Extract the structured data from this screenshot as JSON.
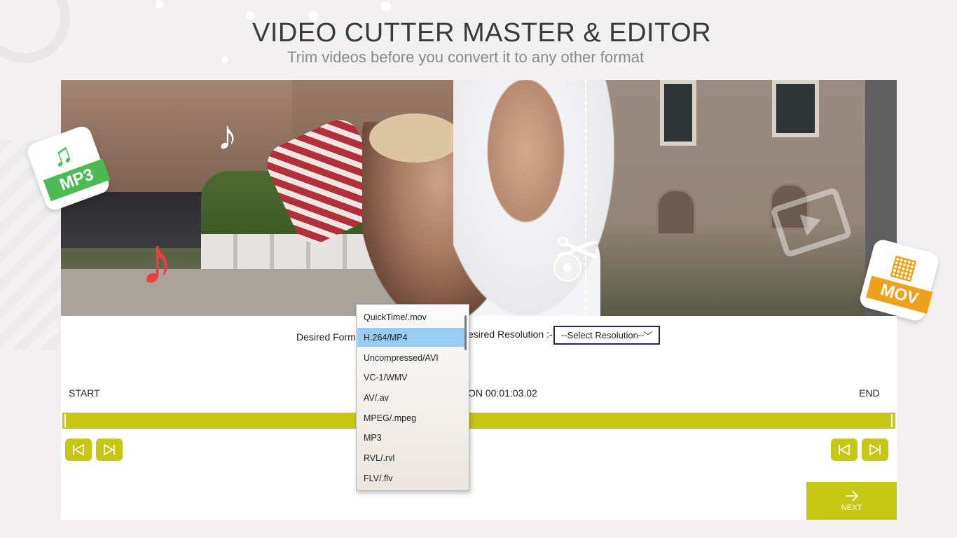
{
  "header": {
    "title": "VIDEO CUTTER MASTER & EDITOR",
    "subtitle": "Trim videos before you convert it to any other format"
  },
  "badges": {
    "mp3": "MP3",
    "mov": "MOV"
  },
  "controls": {
    "format_label": "Desired Form",
    "resolution_label": "esired Resolution :-",
    "resolution_select": "--Select Resolution--",
    "start_label": "START",
    "duration_label": "ON  00:01:03.02",
    "end_label": "END",
    "next_label": "NEXT"
  },
  "format_dropdown": {
    "selected": "H.264/MP4",
    "options": [
      "QuickTime/.mov",
      "H.264/MP4",
      "Uncompressed/AVI",
      "VC-1/WMV",
      "AV/.av",
      "MPEG/.mpeg",
      "MP3",
      "RVL/.rvl",
      "FLV/.flv"
    ]
  },
  "colors": {
    "accent": "#c6c614",
    "mp3_badge": "#4dbb53",
    "mov_badge": "#f0a11c",
    "note_red": "#ec3f3f",
    "dropdown_selected": "#99ccf3"
  },
  "icons": {
    "prev_frame": "skip-back-icon",
    "next_frame": "skip-forward-icon",
    "next": "arrow-right-icon"
  }
}
